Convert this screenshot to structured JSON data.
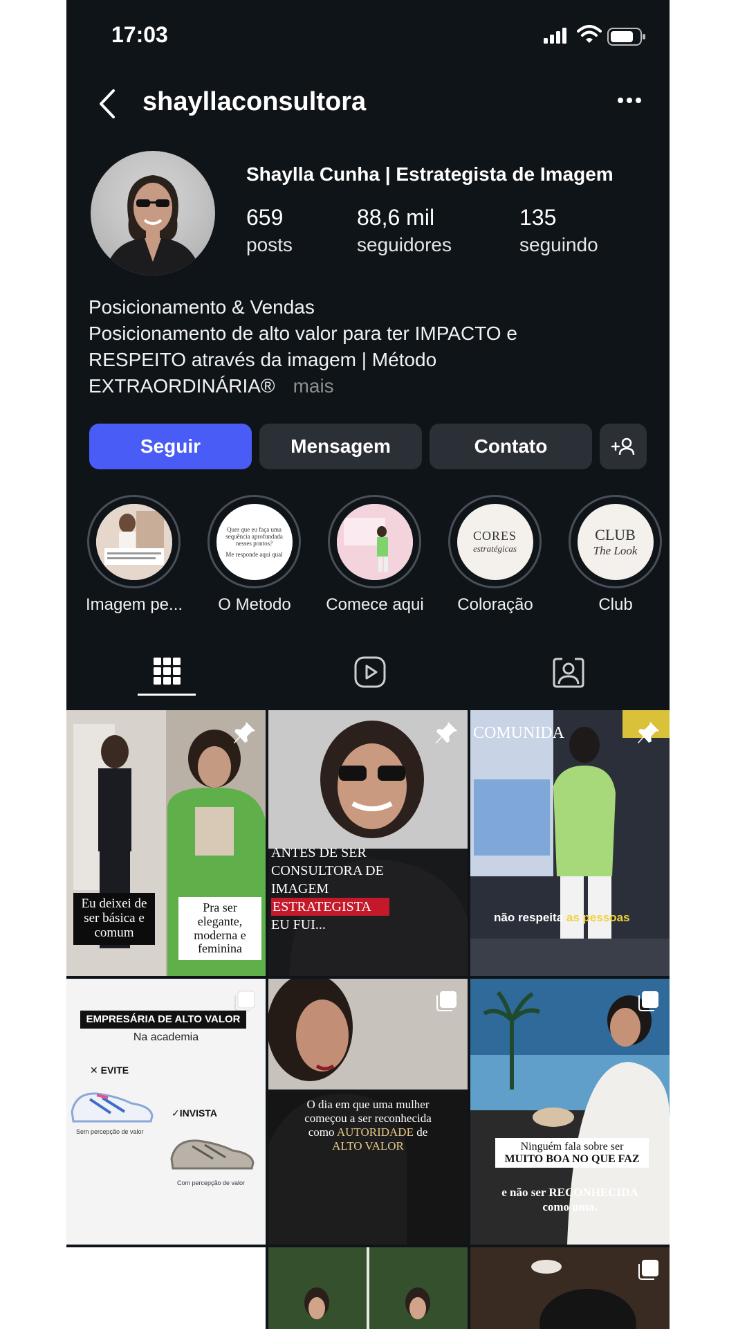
{
  "status_bar": {
    "time": "17:03"
  },
  "header": {
    "username": "shayllaconsultora"
  },
  "profile": {
    "display_name": "Shaylla Cunha | Estrategista de Imagem",
    "stats": [
      {
        "value": "659",
        "label": "posts"
      },
      {
        "value": "88,6 mil",
        "label": "seguidores"
      },
      {
        "value": "135",
        "label": "seguindo"
      }
    ],
    "bio": [
      "Posicionamento & Vendas",
      "Posicionamento de alto valor para ter IMPACTO e",
      "RESPEITO através da imagem | Método",
      "EXTRAORDINÁRIA®"
    ],
    "bio_more": "mais"
  },
  "actions": {
    "follow": "Seguir",
    "message": "Mensagem",
    "contact": "Contato"
  },
  "highlights": [
    {
      "label": "Imagem pe..."
    },
    {
      "label": "O Metodo",
      "cover_text": [
        "Quer que eu faça uma",
        "sequência aprofundada",
        "nesses pontos?",
        "Me responde aqui qual"
      ]
    },
    {
      "label": "Comece aqui"
    },
    {
      "label": "Coloração",
      "cover_text": [
        "CORES",
        "estratégicas"
      ]
    },
    {
      "label": "Club",
      "cover_text": [
        "CLUB",
        "The Look"
      ]
    }
  ],
  "tabs": [
    {
      "icon": "grid-icon",
      "active": true
    },
    {
      "icon": "reels-icon",
      "active": false
    },
    {
      "icon": "tagged-icon",
      "active": false
    }
  ],
  "posts": [
    {
      "pinned": true,
      "captions": [
        "Eu deixei de ser básica e comum",
        "Pra ser elegante, moderna e feminina"
      ]
    },
    {
      "pinned": true,
      "captions": [
        "ANTES DE SER",
        "CONSULTORA DE",
        "IMAGEM",
        "ESTRATEGISTA",
        "EU FUI..."
      ]
    },
    {
      "pinned": true,
      "captions": [
        "COMUNIDA",
        "não respeita",
        "as pessoas"
      ]
    },
    {
      "multi": true,
      "captions": [
        "EMPRESÁRIA DE ALTO VALOR",
        "Na academia",
        "EVITE",
        "INVISTA",
        "Sem percepção de valor",
        "Com percepção de valor"
      ]
    },
    {
      "multi": true,
      "captions": [
        "O dia em que uma mulher",
        "começou a ser reconhecida",
        "como",
        "AUTORIDADE",
        "de",
        "ALTO VALOR"
      ]
    },
    {
      "multi": true,
      "captions": [
        "Ninguém fala sobre ser",
        "MUITO BOA NO QUE FAZ",
        "e não ser RECONHECIDA",
        "como uma."
      ]
    }
  ],
  "colors": {
    "background": "#0f1419",
    "button": "#2b2f36",
    "follow": "#4a5cf6",
    "muted": "#8e8e8e"
  }
}
